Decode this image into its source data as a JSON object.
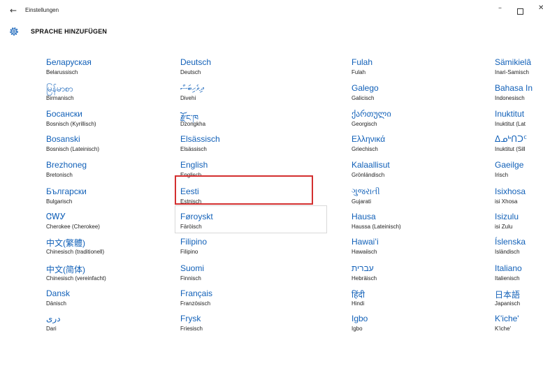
{
  "window": {
    "title": "Einstellungen",
    "back_glyph": "←",
    "minimize_glyph": "–",
    "close_glyph": "✕"
  },
  "header": {
    "title": "SPRACHE HINZUFÜGEN",
    "icon": "gear-icon"
  },
  "colors": {
    "accent": "#1160b8",
    "selection": "#d32f2f"
  },
  "selected_language": "English",
  "languages": [
    [
      {
        "native": "Беларуская",
        "german": "Belarussisch"
      },
      {
        "native": "မြန်မာစာ",
        "german": "Birmanisch"
      },
      {
        "native": "Босански",
        "german": "Bosnisch (Kyrillisch)"
      },
      {
        "native": "Bosanski",
        "german": "Bosnisch (Lateinisch)"
      },
      {
        "native": "Brezhoneg",
        "german": "Bretonisch"
      },
      {
        "native": "Български",
        "german": "Bulgarisch"
      },
      {
        "native": "ᏣᎳᎩ",
        "german": "Cherokee (Cherokee)"
      },
      {
        "native": "中文(繁體)",
        "german": "Chinesisch (traditionell)"
      },
      {
        "native": "中文(简体)",
        "german": "Chinesisch (vereinfacht)"
      },
      {
        "native": "Dansk",
        "german": "Dänisch"
      },
      {
        "native": "دری",
        "german": "Dari"
      }
    ],
    [
      {
        "native": "Deutsch",
        "german": "Deutsch"
      },
      {
        "native": "ދިވެހިބަސް",
        "german": "Divehi"
      },
      {
        "native": "རྫོང་ཁ",
        "german": "Dzongkha"
      },
      {
        "native": "Elsässisch",
        "german": "Elsässisch"
      },
      {
        "native": "English",
        "german": "Englisch"
      },
      {
        "native": "Eesti",
        "german": "Estnisch"
      },
      {
        "native": "Føroyskt",
        "german": "Färöisch"
      },
      {
        "native": "Filipino",
        "german": "Filipino"
      },
      {
        "native": "Suomi",
        "german": "Finnisch"
      },
      {
        "native": "Français",
        "german": "Französisch"
      },
      {
        "native": "Frysk",
        "german": "Friesisch"
      }
    ],
    [
      {
        "native": "Fulah",
        "german": "Fulah"
      },
      {
        "native": "Galego",
        "german": "Galicisch"
      },
      {
        "native": "ქართული",
        "german": "Georgisch"
      },
      {
        "native": "Ελληνικά",
        "german": "Griechisch"
      },
      {
        "native": "Kalaallisut",
        "german": "Grönländisch"
      },
      {
        "native": "ગુજરાતી",
        "german": "Gujarati"
      },
      {
        "native": "Hausa",
        "german": "Haussa (Lateinisch)"
      },
      {
        "native": "Hawaiʻi",
        "german": "Hawaiisch"
      },
      {
        "native": "עברית",
        "german": "Hebräisch"
      },
      {
        "native": "हिंदी",
        "german": "Hindi"
      },
      {
        "native": "Igbo",
        "german": "Igbo"
      }
    ],
    [
      {
        "native": "Sämikielâ",
        "german": "Inari-Samisch"
      },
      {
        "native": "Bahasa In",
        "german": "Indonesisch"
      },
      {
        "native": "Inuktitut",
        "german": "Inuktitut (Lat"
      },
      {
        "native": "ᐃᓄᒃᑎᑐᑦ",
        "german": "Inuktitut (Sill"
      },
      {
        "native": "Gaeilge",
        "german": "Irisch"
      },
      {
        "native": "Isixhosa",
        "german": "isi Xhosa"
      },
      {
        "native": "Isizulu",
        "german": "isi Zulu"
      },
      {
        "native": "Íslenska",
        "german": "Isländisch"
      },
      {
        "native": "Italiano",
        "german": "Italienisch"
      },
      {
        "native": "日本語",
        "german": "Japanisch"
      },
      {
        "native": "K'iche'",
        "german": "K'iche'"
      }
    ]
  ]
}
